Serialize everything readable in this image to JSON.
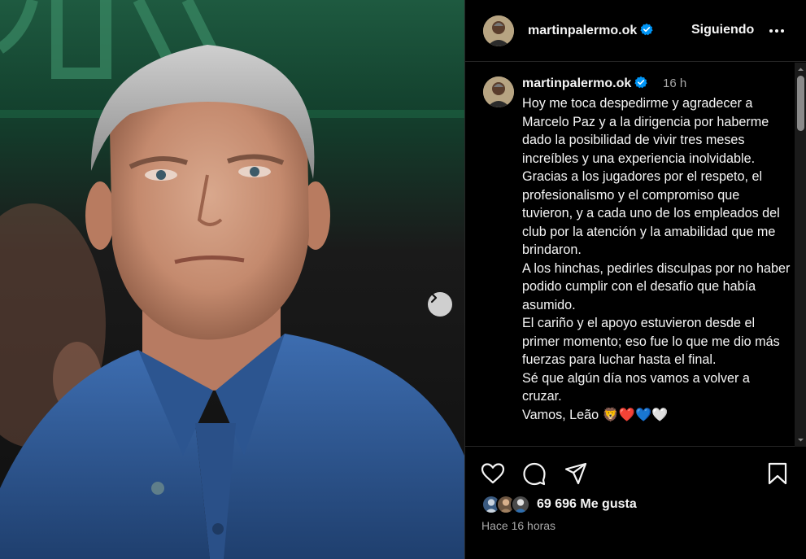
{
  "post": {
    "username": "martinpalermo.ok",
    "follow_label": "Siguiendo",
    "more_label": "Más opciones",
    "caption_time": "16 h",
    "caption": "Hoy me toca despedirme y agradecer a Marcelo Paz y a la dirigencia por haberme dado la posibilidad de vivir tres meses increíbles y una experiencia inolvidable.\nGracias a los jugadores por el respeto, el profesionalismo y el compromiso que tuvieron, y a cada uno de los empleados del club por la atención y la amabilidad que me brindaron.\nA los hinchas, pedirles disculpas por no haber podido cumplir con el desafío que había asumido.\nEl cariño y el apoyo estuvieron desde el primer momento; eso fue lo que me dio más fuerzas para luchar hasta el final.\nSé que algún día nos vamos a volver a cruzar.\nVamos, Leão 🦁❤️💙🤍",
    "likes": "69 696 Me gusta",
    "posted_ago": "Hace 16 horas"
  },
  "icons": {
    "next": "chevron-right-icon",
    "like": "heart-icon",
    "comment": "comment-icon",
    "share": "send-icon",
    "save": "bookmark-icon",
    "verified": "verified-badge-icon",
    "more": "more-dots-icon"
  },
  "colors": {
    "background": "#000000",
    "text": "#f5f5f5",
    "secondary_text": "#a8a8a8",
    "verified_blue": "#0095f6",
    "shirt_blue": "#2f5c98"
  }
}
